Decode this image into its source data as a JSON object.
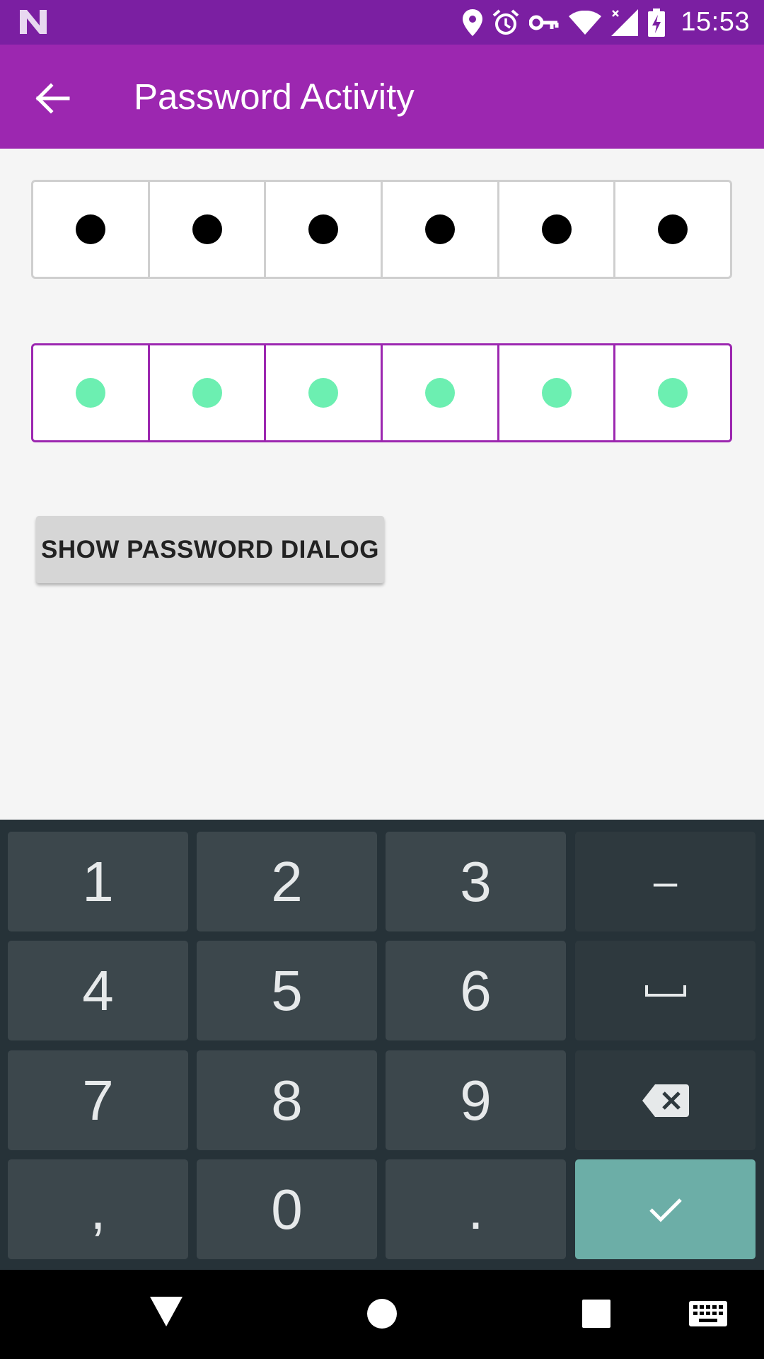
{
  "status_bar": {
    "time": "15:53",
    "icons": [
      "n-logo-icon",
      "location-icon",
      "alarm-icon",
      "vpn-key-icon",
      "wifi-icon",
      "signal-icon",
      "battery-charging-icon"
    ]
  },
  "app_bar": {
    "title": "Password Activity",
    "back_icon": "arrow-back-icon"
  },
  "password_field_1": {
    "length": 6,
    "filled": 6,
    "dot_color": "#000000",
    "border_color": "#cfcfcf"
  },
  "password_field_2": {
    "length": 6,
    "filled": 6,
    "dot_color": "#6cefb1",
    "border_color": "#9c27b0"
  },
  "show_button": {
    "label": "SHOW PASSWORD DIALOG"
  },
  "keyboard": {
    "keys": {
      "k1": "1",
      "k2": "2",
      "k3": "3",
      "dash": "–",
      "k4": "4",
      "k5": "5",
      "k6": "6",
      "space": "space-icon",
      "k7": "7",
      "k8": "8",
      "k9": "9",
      "delete": "backspace-icon",
      "comma": ",",
      "k0": "0",
      "period": ".",
      "done": "check-icon"
    }
  },
  "nav_bar": {
    "buttons": [
      "back-triangle-icon",
      "home-circle-icon",
      "recents-square-icon",
      "keyboard-icon"
    ]
  },
  "colors": {
    "status_bar": "#7b1fa2",
    "app_bar": "#9c27b0",
    "accent": "#6cefb1",
    "keyboard_bg": "#263238",
    "enter_key": "#6caea7"
  }
}
